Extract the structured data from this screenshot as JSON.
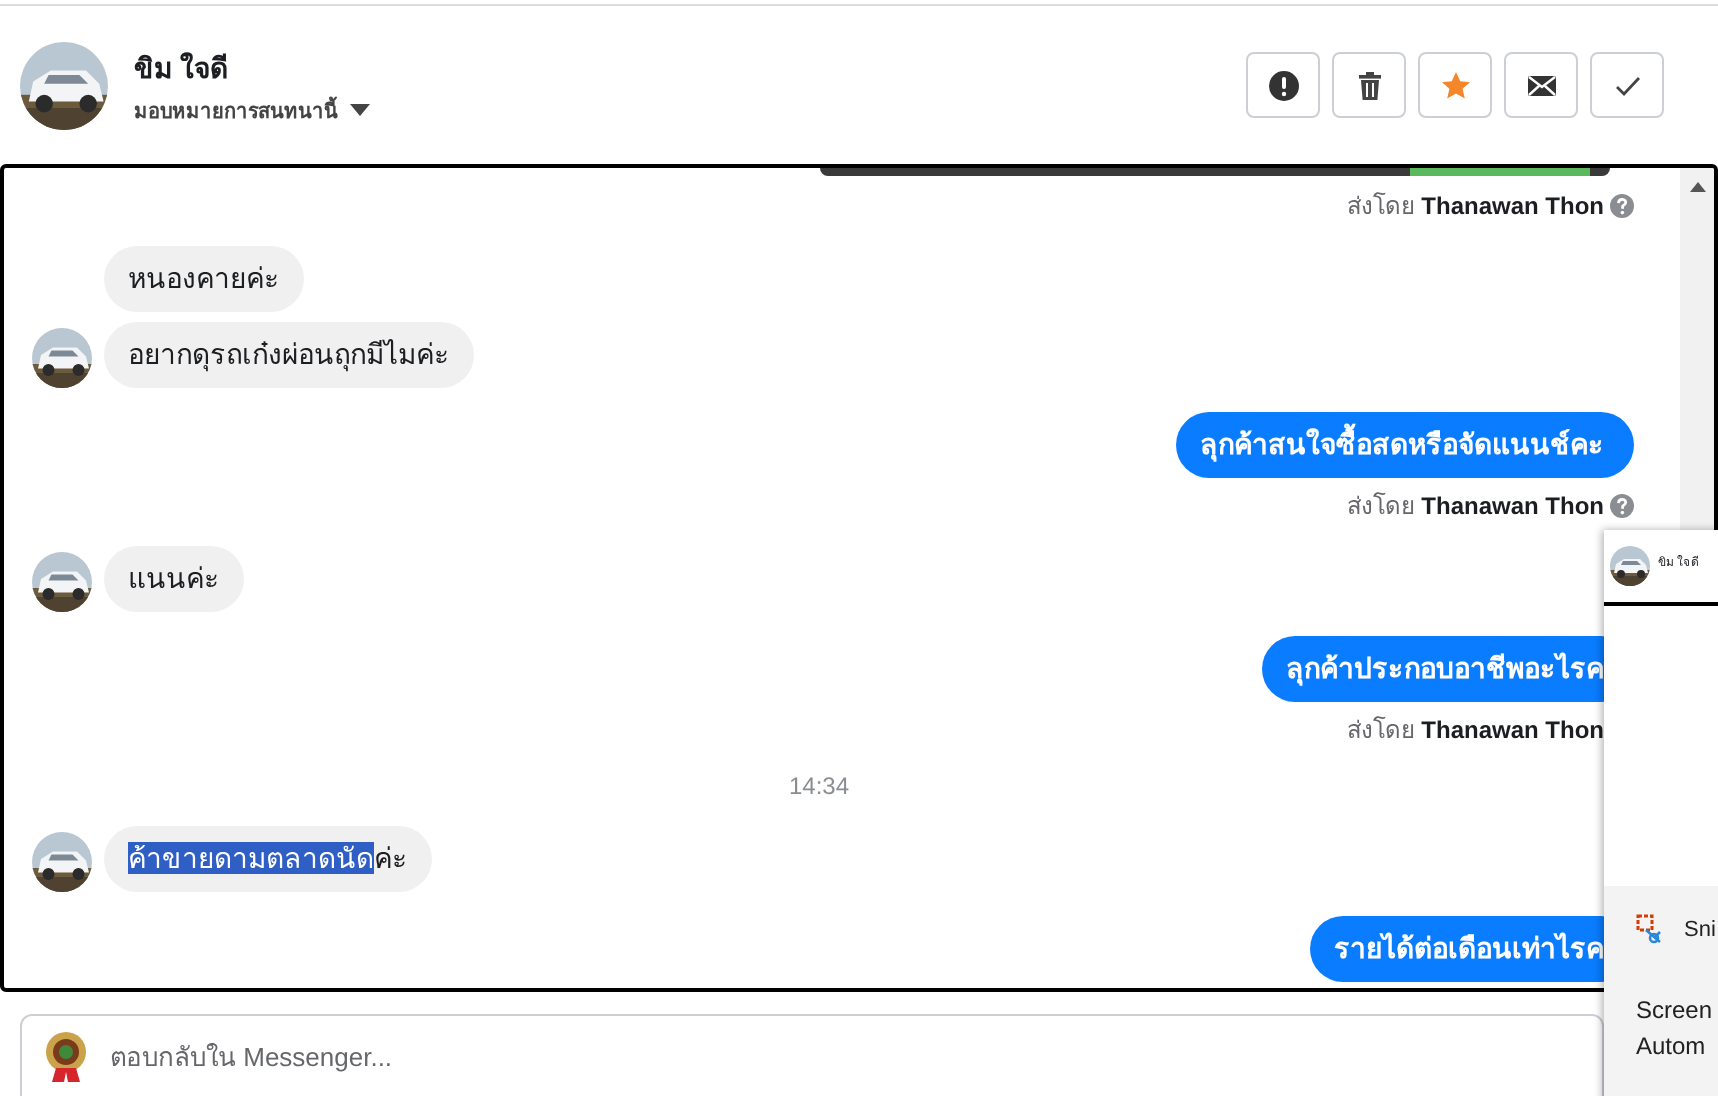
{
  "header": {
    "name": "ขิม ใจดี",
    "assign_label": "มอบหมายการสนทนานี้",
    "actions": [
      {
        "kind": "alert",
        "on": false
      },
      {
        "kind": "trash",
        "on": false
      },
      {
        "kind": "star",
        "on": true
      },
      {
        "kind": "mail",
        "on": false
      },
      {
        "kind": "check",
        "on": false
      }
    ]
  },
  "messages": [
    {
      "kind": "image_tail"
    },
    {
      "kind": "sent_by",
      "text": "ส่งโดย **Thanawan Thon**",
      "help_icon": true
    },
    {
      "kind": "incoming",
      "text": "หนองคายค่ะ",
      "avatar": false
    },
    {
      "kind": "incoming",
      "text": "อยากดุรถเก๋งผ่อนถุกมีไมค่ะ",
      "avatar": true
    },
    {
      "kind": "outgoing",
      "text": "ลุกค้าสนใจซื้อสดหรือจัดแนนช์คะ"
    },
    {
      "kind": "sent_by",
      "text": "ส่งโดย **Thanawan Thon**",
      "help_icon": true
    },
    {
      "kind": "incoming",
      "text": "แนนค่ะ",
      "avatar": true
    },
    {
      "kind": "outgoing",
      "text": "ลุกค้าประกอบอาชีพอะไรค"
    },
    {
      "kind": "sent_by",
      "text": "ส่งโดย **Thanawan Thon**"
    },
    {
      "kind": "time",
      "text": "14:34"
    },
    {
      "kind": "incoming",
      "segments": [
        {
          "text": "ค้าขายดามตลาดนัด",
          "selected": true
        },
        {
          "text": "ค่ะ",
          "selected": false
        }
      ],
      "avatar": true
    },
    {
      "kind": "outgoing",
      "text": "รายได้ต่อเดือนเท่าไรค"
    }
  ],
  "reply": {
    "placeholder": "ตอบกลับใน Messenger..."
  },
  "popup": {
    "title": "ขิม ใจดี",
    "app": "Sni",
    "line_1": "Screen",
    "line_2": "Autom"
  }
}
